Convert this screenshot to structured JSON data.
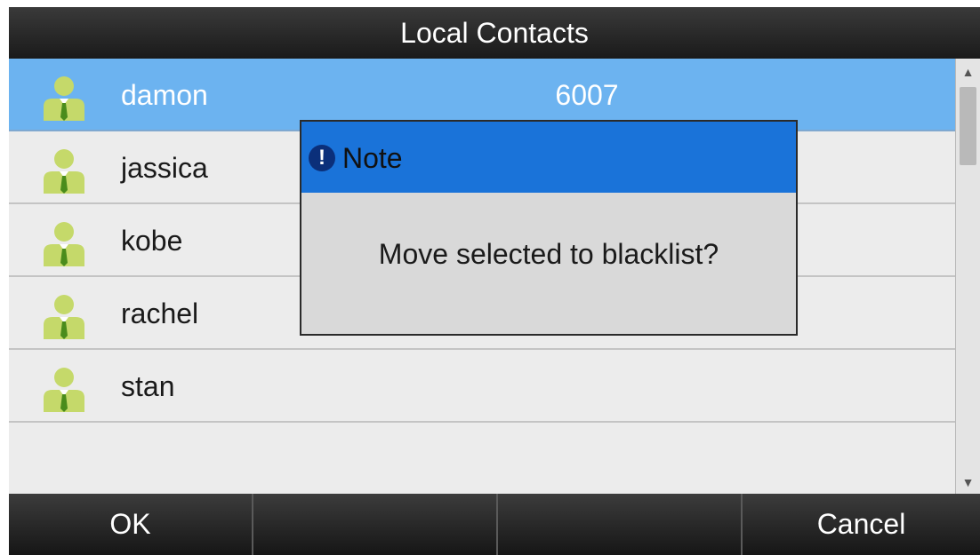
{
  "window": {
    "title": "Local Contacts"
  },
  "contacts": [
    {
      "name": "damon",
      "number": "6007",
      "selected": true
    },
    {
      "name": "jassica",
      "number": "",
      "selected": false
    },
    {
      "name": "kobe",
      "number": "",
      "selected": false
    },
    {
      "name": "rachel",
      "number": "",
      "selected": false
    },
    {
      "name": "stan",
      "number": "",
      "selected": false
    }
  ],
  "dialog": {
    "icon": "exclamation-icon",
    "title": "Note",
    "message": "Move selected to blacklist?"
  },
  "softkeys": [
    "OK",
    "",
    "",
    "Cancel"
  ],
  "icons": {
    "contact": "contact-avatar-icon",
    "scroll_up": "scroll-up-icon",
    "scroll_down": "scroll-down-icon"
  },
  "colors": {
    "selected_row": "#6cb3f0",
    "dialog_header": "#1a73d9",
    "avatar": "#c5d96a",
    "tie": "#4a8c1c"
  }
}
